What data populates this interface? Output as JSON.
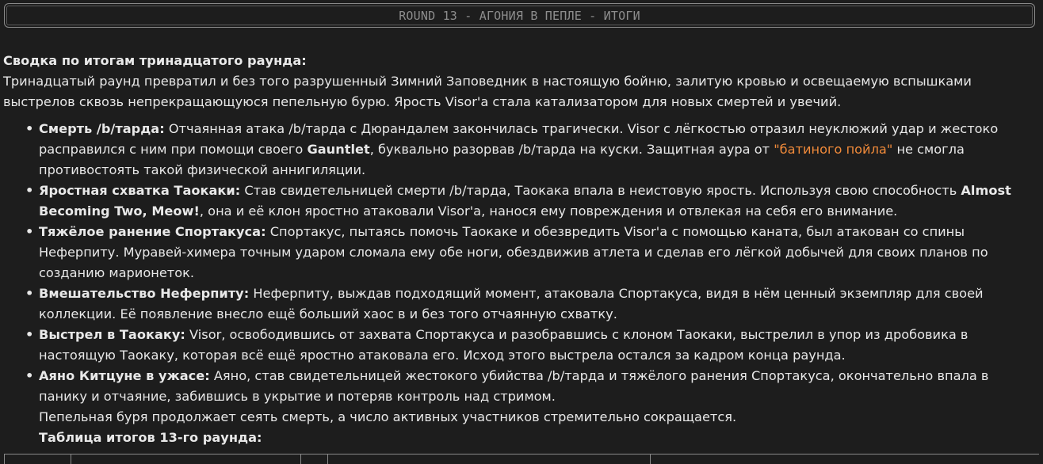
{
  "header": {
    "title": "ROUND 13 - АГОНИЯ В ПЕПЛЕ - ИТОГИ"
  },
  "summary": {
    "heading": "Сводка по итогам тринадцатого раунда:",
    "intro": "Тринадцатый раунд превратил и без того разрушенный Зимний Заповедник в настоящую бойню, залитую кровью и освещаемую вспышками выстрелов сквозь непрекращающуюся пепельную бурю. Ярость Visor'а стала катализатором для новых смертей и увечий."
  },
  "events": [
    {
      "title": "Смерть /b/тарда:",
      "t1": " Отчаянная атака /b/тарда с Дюрандалем закончилась трагически. Visor с лёгкостью отразил неуклюжий удар и жестоко расправился с ним при помощи своего ",
      "bold1": "Gauntlet",
      "t2": ", буквально разорвав /b/тарда на куски. Защитная аура от ",
      "highlight": "\"батиного пойла\"",
      "t3": " не смогла противостоять такой физической аннигиляции."
    },
    {
      "title": "Яростная схватка Таокаки:",
      "t1": " Став свидетельницей смерти /b/тарда, Таокака впала в неистовую ярость. Используя свою способность ",
      "bold1": "Almost Becoming Two, Meow!",
      "t2": ", она и её клон яростно атаковали Visor'а, нанося ему повреждения и отвлекая на себя его внимание."
    },
    {
      "title": "Тяжёлое ранение Спортакуса:",
      "t1": " Спортакус, пытаясь помочь Таокаке и обезвредить Visor'а с помощью каната, был атакован со спины Неферпиту. Муравей-химера точным ударом сломала ему обе ноги, обездвижив атлета и сделав его лёгкой добычей для своих планов по созданию марионеток."
    },
    {
      "title": "Вмешательство Неферпиту:",
      "t1": " Неферпиту, выждав подходящий момент, атаковала Спортакуса, видя в нём ценный экземпляр для своей коллекции. Её появление внесло ещё больший хаос в и без того отчаянную схватку."
    },
    {
      "title": "Выстрел в Таокаку:",
      "t1": " Visor, освободившись от захвата Спортакуса и разобравшись с клоном Таокаки, выстрелил в упор из дробовика в настоящую Таокаку, которая всё ещё яростно атаковала его. Исход этого выстрела остался за кадром конца раунда."
    },
    {
      "title": "Аяно Китцуне в ужасе:",
      "t1": " Аяно, став свидетельницей жестокого убийства /b/тарда и тяжёлого ранения Спортакуса, окончательно впала в панику и отчаяние, забившись в укрытие и потеряв контроль над стримом."
    }
  ],
  "closing": "Пепельная буря продолжает сеять смерть, а число активных участников стремительно сокращается.",
  "table_title": "Таблица итогов 13-го раунда:",
  "colors": {
    "background": "#1d1d1d",
    "text": "#e8e8e8",
    "highlight": "#f08a3a",
    "header_text": "#8d8d8d",
    "border": "#8a8a8a"
  }
}
